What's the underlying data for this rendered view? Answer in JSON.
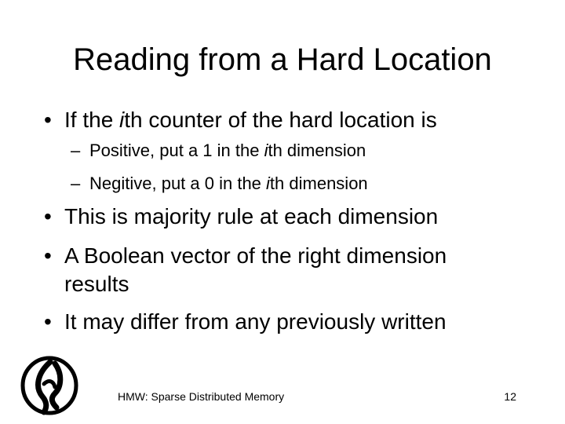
{
  "slide": {
    "title": "Reading from a Hard Location",
    "bullets": [
      {
        "pre": "If the ",
        "em": "i",
        "post": "th counter of the hard location is",
        "sub": [
          {
            "pre": "Positive, put a 1 in the ",
            "em": "i",
            "post": "th dimension"
          },
          {
            "pre": "Negitive, put a 0 in the ",
            "em": "i",
            "post": "th dimension"
          }
        ]
      },
      {
        "text": "This is majority rule at each dimension"
      },
      {
        "line1": "A Boolean vector of the right dimension",
        "line2": "results"
      },
      {
        "text": "It may differ from any previously written"
      }
    ],
    "bullet_symbol": "•",
    "dash_symbol": "–",
    "footer": "HMW: Sparse Distributed Memory",
    "page_number": "12",
    "logo_icon": "spiral-logo-icon"
  }
}
